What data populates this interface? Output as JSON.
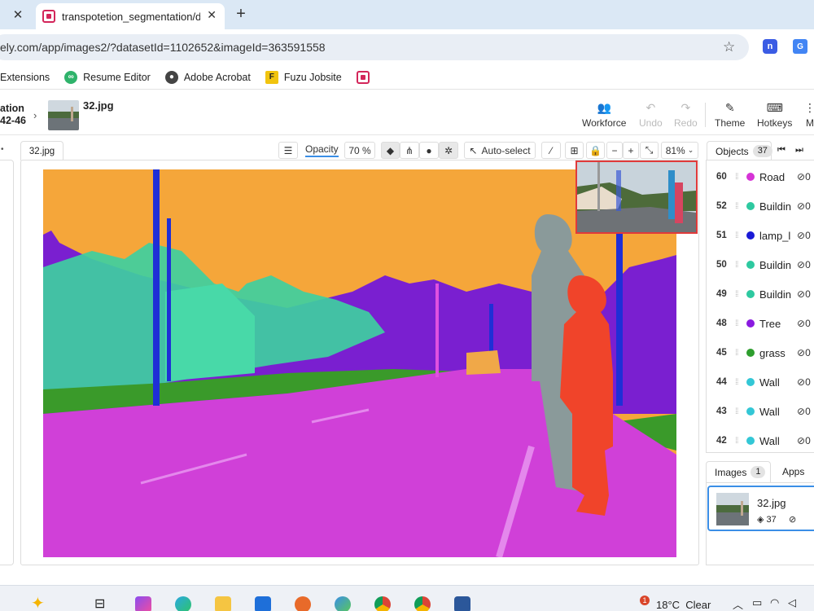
{
  "browser": {
    "inactive_tab_close": "✕",
    "active_tab_title": "transpotetion_segmentation/da",
    "active_tab_close": "✕",
    "new_tab": "+",
    "url": "ely.com/app/images2/?datasetId=1102652&imageId=363591558",
    "bookmarks": [
      "Extensions",
      "Resume Editor",
      "Adobe Acrobat",
      "Fuzu Jobsite"
    ]
  },
  "header": {
    "project_line1": "ation",
    "project_line2": "42-46",
    "breadcrumb_arrow": "›",
    "image_name": "32.jpg",
    "buttons": [
      {
        "label": "Workforce",
        "icon": "people-icon",
        "enabled": true
      },
      {
        "label": "Undo",
        "icon": "undo-icon",
        "enabled": false
      },
      {
        "label": "Redo",
        "icon": "redo-icon",
        "enabled": false
      },
      {
        "label": "Theme",
        "icon": "theme-icon",
        "enabled": true
      },
      {
        "label": "Hotkeys",
        "icon": "keyboard-icon",
        "enabled": true
      },
      {
        "label": "M",
        "icon": "more-icon",
        "enabled": true
      }
    ]
  },
  "canvas": {
    "tab_label": "32.jpg",
    "opacity_label": "Opacity",
    "opacity_value": "70",
    "opacity_unit": "%",
    "autoselect_label": "Auto-select",
    "zoom_out": "−",
    "zoom_in": "+",
    "zoom_level": "81%"
  },
  "objects": {
    "tab_label": "Objects",
    "count": "37",
    "items": [
      {
        "id": "60",
        "name": "Road",
        "color": "#d633d6",
        "tags": "0"
      },
      {
        "id": "52",
        "name": "Buildin",
        "color": "#2ec9a0",
        "tags": "0"
      },
      {
        "id": "51",
        "name": "lamp_l",
        "color": "#1a1ad6",
        "tags": "0"
      },
      {
        "id": "50",
        "name": "Buildin",
        "color": "#2ec9a0",
        "tags": "0"
      },
      {
        "id": "49",
        "name": "Buildin",
        "color": "#2ec9a0",
        "tags": "0"
      },
      {
        "id": "48",
        "name": "Tree",
        "color": "#8a1ae0",
        "tags": "0"
      },
      {
        "id": "45",
        "name": "grass",
        "color": "#2e9e2e",
        "tags": "0"
      },
      {
        "id": "44",
        "name": "Wall",
        "color": "#33c7d6",
        "tags": "0"
      },
      {
        "id": "43",
        "name": "Wall",
        "color": "#33c7d6",
        "tags": "0"
      },
      {
        "id": "42",
        "name": "Wall",
        "color": "#33c7d6",
        "tags": "0"
      }
    ]
  },
  "images_panel": {
    "images_tab": "Images",
    "images_count": "1",
    "apps_tab": "Apps",
    "card_name": "32.jpg",
    "card_objects": "37"
  },
  "taskbar": {
    "temperature": "18°C",
    "condition": "Clear",
    "notification_count": "1"
  },
  "colors": {
    "sky": "#f5a63a",
    "road": "#d040d8",
    "tree": "#7a1fd0",
    "building": "#3ecfa0",
    "pole": "#1f2fd6",
    "person_adult": "#8a9a9a",
    "person_child": "#f0442a",
    "grass": "#3a9a2a",
    "accent": "#3a8ee6"
  }
}
